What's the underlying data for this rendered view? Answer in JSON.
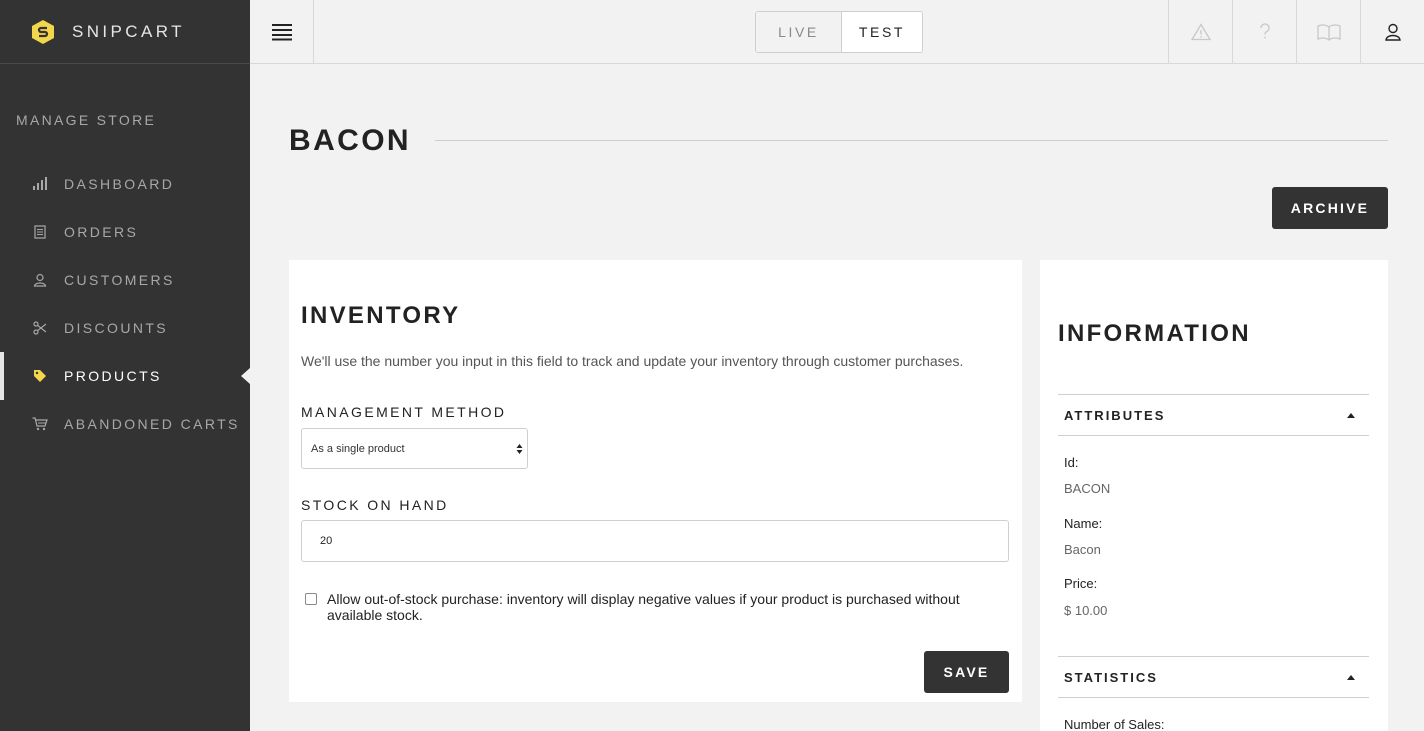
{
  "brand": {
    "name": "SNIPCART",
    "logo_icon": "snipcart-logo-icon",
    "accent": "#f2d64b"
  },
  "sidebar": {
    "section_title": "MANAGE STORE",
    "items": [
      {
        "label": "DASHBOARD",
        "icon": "bar-chart-icon"
      },
      {
        "label": "ORDERS",
        "icon": "receipt-icon"
      },
      {
        "label": "CUSTOMERS",
        "icon": "user-icon"
      },
      {
        "label": "DISCOUNTS",
        "icon": "scissors-icon"
      },
      {
        "label": "PRODUCTS",
        "icon": "tag-icon",
        "active": true
      },
      {
        "label": "ABANDONED CARTS",
        "icon": "cart-icon"
      }
    ]
  },
  "topbar": {
    "env": {
      "live_label": "LIVE",
      "test_label": "TEST",
      "selected": "TEST"
    },
    "icons": [
      "warning-icon",
      "help-icon",
      "docs-book-icon",
      "account-icon"
    ]
  },
  "page": {
    "title": "BACON",
    "archive_label": "ARCHIVE"
  },
  "inventory": {
    "title": "INVENTORY",
    "description": "We'll use the number you input in this field to track and update your inventory through customer purchases.",
    "method_label": "MANAGEMENT METHOD",
    "method_value": "As a single product",
    "stock_label": "STOCK ON HAND",
    "stock_value": "20",
    "allow_out_of_stock_text": "Allow out-of-stock purchase: inventory will display negative values if your product is purchased without available stock.",
    "allow_out_of_stock_checked": false,
    "save_label": "SAVE"
  },
  "information": {
    "title": "INFORMATION",
    "attributes_header": "ATTRIBUTES",
    "attributes": [
      {
        "label": "Id:",
        "value": "BACON"
      },
      {
        "label": "Name:",
        "value": "Bacon"
      },
      {
        "label": "Price:",
        "value": "$ 10.00"
      }
    ],
    "statistics_header": "STATISTICS",
    "statistics": [
      {
        "label": "Number of Sales:"
      }
    ]
  }
}
